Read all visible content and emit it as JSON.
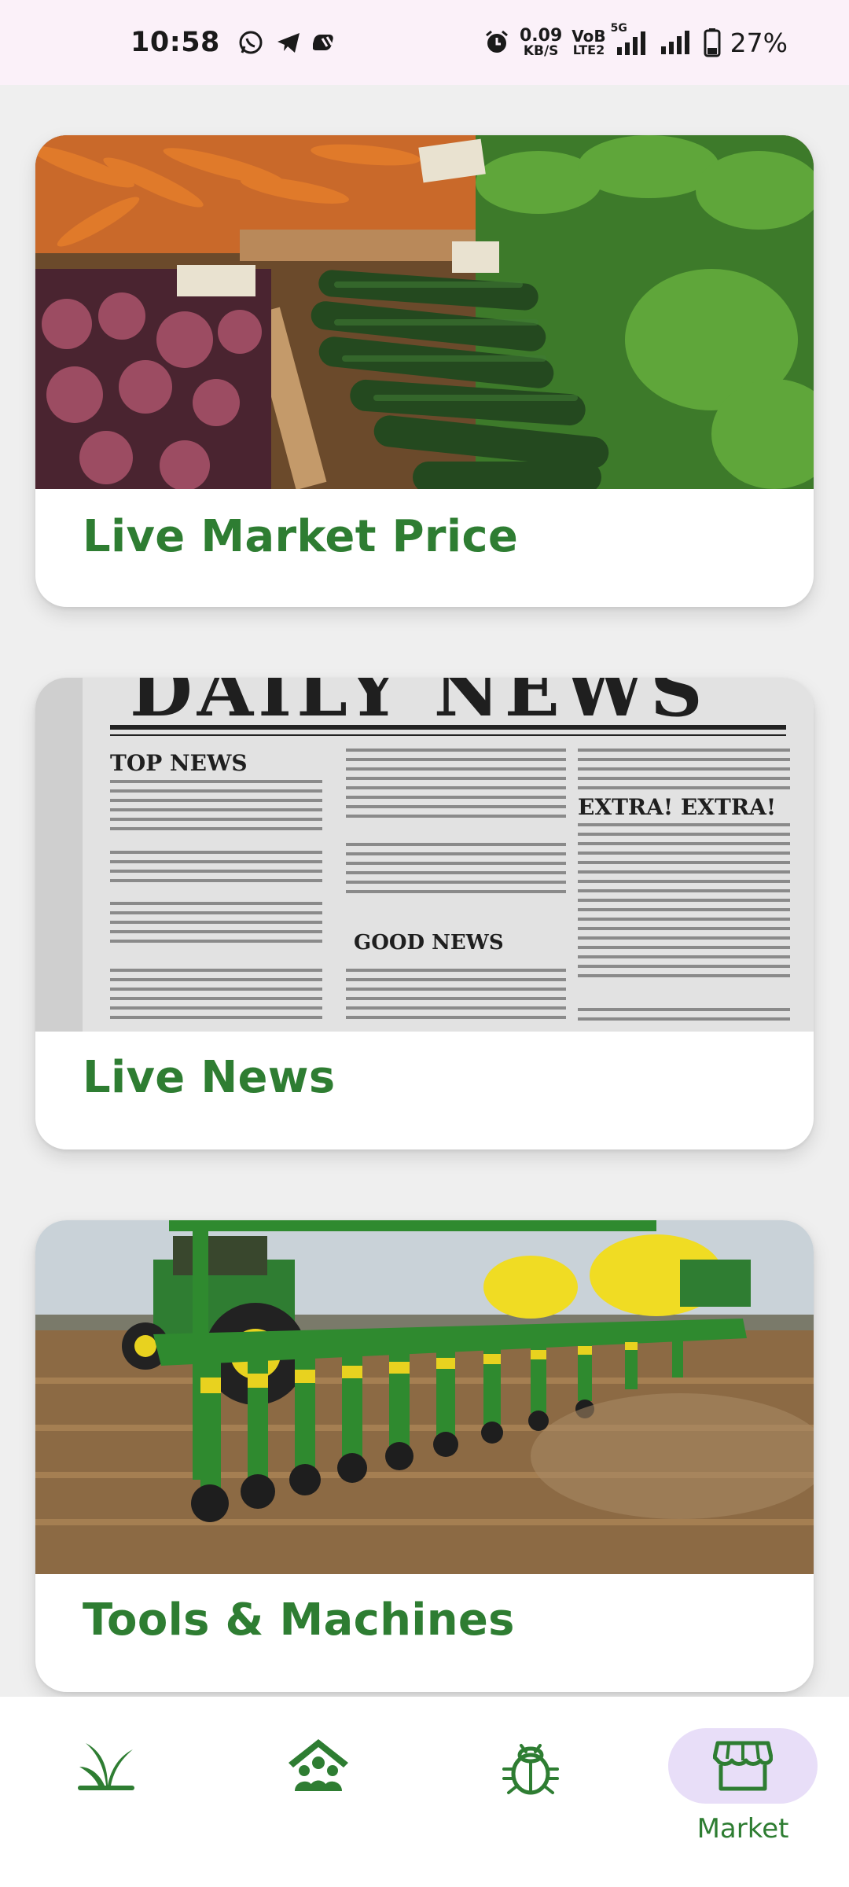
{
  "status_bar": {
    "time": "10:58",
    "net_speed_value": "0.09",
    "net_speed_unit": "KB/S",
    "volte_top": "VoB",
    "volte_bottom": "LTE2",
    "network": "5G",
    "battery": "27%",
    "icons": [
      "whatsapp-icon",
      "telegram-icon",
      "app-icon",
      "alarm-icon",
      "signal-icon",
      "signal-icon",
      "battery-icon"
    ]
  },
  "cards": {
    "market": {
      "title": "Live Market Price"
    },
    "news": {
      "title": "Live News",
      "newspaper": {
        "masthead": "DAILY NEWS",
        "top_news": "TOP NEWS",
        "good_news": "GOOD NEWS",
        "extra": "EXTRA! EXTRA!"
      }
    },
    "tools": {
      "title": "Tools & Machines"
    }
  },
  "bottom_nav": {
    "items": [
      {
        "icon": "crop-sprout-icon"
      },
      {
        "icon": "community-home-icon"
      },
      {
        "icon": "pest-bug-icon"
      },
      {
        "icon": "market-store-icon",
        "label": "Market",
        "active": true
      }
    ]
  },
  "colors": {
    "accent_green": "#2e7d32",
    "active_pill": "#e8def8",
    "background": "#efefef",
    "status_bar": "#fbf1f9"
  }
}
